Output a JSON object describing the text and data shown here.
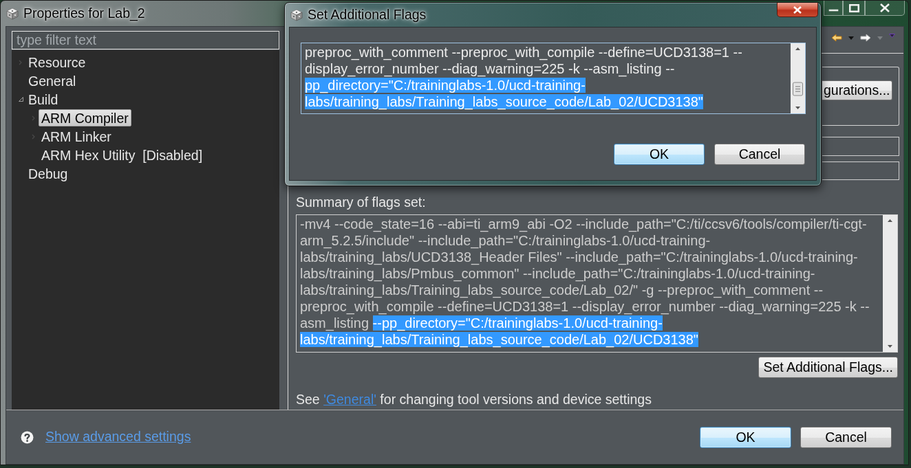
{
  "window": {
    "title": "Properties for Lab_2"
  },
  "dialog": {
    "title": "Set Additional Flags",
    "flags": [
      {
        "text": "preproc_with_comment --preproc_with_compile --define=UCD3138=1 --display_error_number --diag_warning=225 -k --asm_listing --",
        "selected": false
      },
      {
        "text": "pp_directory=\"C:/traininglabs-1.0/ucd-training-labs/training_labs/Training_labs_source_code/Lab_02/UCD3138\"",
        "selected": true
      }
    ],
    "buttons": [
      {
        "label": "OK",
        "default": true
      },
      {
        "label": "Cancel",
        "default": false
      }
    ]
  },
  "filter": {
    "placeholder": "type filter text"
  },
  "tree": [
    {
      "label": "Resource",
      "expanded": false,
      "selected": false
    },
    {
      "label": "General",
      "selected": false
    },
    {
      "label": "Build",
      "expanded": true,
      "selected": false,
      "children": [
        {
          "label": "ARM Compiler",
          "expanded": false,
          "selected": true
        },
        {
          "label": "ARM Linker",
          "expanded": false,
          "selected": false
        },
        {
          "label": "ARM Hex Utility  [Disabled]",
          "selected": false
        }
      ]
    },
    {
      "label": "Debug",
      "selected": false
    }
  ],
  "panel": {
    "configurations_button": "gurations...",
    "summary_label": "Summary of flags set:",
    "summary": [
      {
        "text": "-mv4 --code_state=16 --abi=ti_arm9_abi -O2 --include_path=\"C:/ti/ccsv6/tools/compiler/ti-cgt-arm_5.2.5/include\" --include_path=\"C:/traininglabs-1.0/ucd-training-labs/training_labs/UCD3138_Header Files\" --include_path=\"C:/traininglabs-1.0/ucd-training-labs/training_labs/Pmbus_common\" --include_path=\"C:/traininglabs-1.0/ucd-training-labs/training_labs/Training_labs_source_code/Lab_02/\" -g --preproc_with_comment --preproc_with_compile --define=UCD3138=1 --display_error_number --diag_warning=225 -k --asm_listing ",
        "selected": false
      },
      {
        "text": "--pp_directory=\"C:/traininglabs-1.0/ucd-training-labs/training_labs/Training_labs_source_code/Lab_02/UCD3138\"",
        "selected": true
      }
    ],
    "set_flags_button": "Set Additional Flags...",
    "note": {
      "before": "See ",
      "link": "'General'",
      "after": " for changing tool versions and device settings"
    }
  },
  "footer": {
    "help_link": "Show advanced settings",
    "buttons": [
      {
        "label": "OK",
        "default": true
      },
      {
        "label": "Cancel",
        "default": false
      }
    ]
  }
}
